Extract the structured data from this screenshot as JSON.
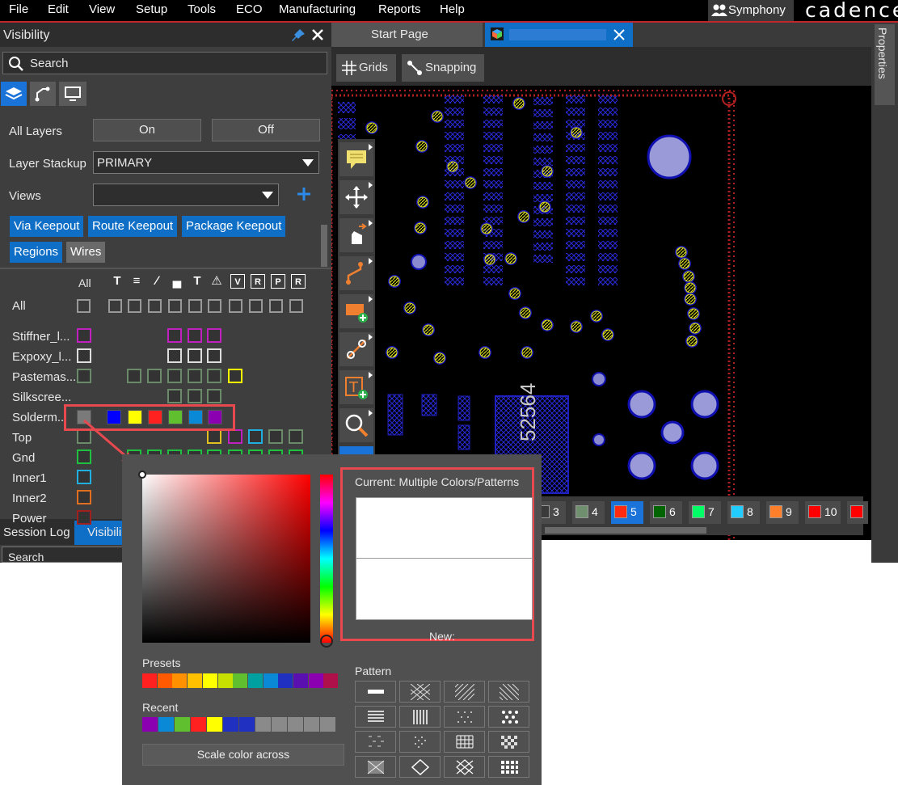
{
  "menubar": {
    "items": [
      "File",
      "Edit",
      "View",
      "Setup",
      "Tools",
      "ECO",
      "Manufacturing",
      "Reports",
      "Help"
    ],
    "symphony": "Symphony",
    "logo": "cadence"
  },
  "panel": {
    "title": "Visibility",
    "search_placeholder": "Search",
    "all_layers_label": "All Layers",
    "on_label": "On",
    "off_label": "Off",
    "layer_stackup_label": "Layer Stackup",
    "layer_stackup_value": "PRIMARY",
    "views_label": "Views",
    "chips": [
      "Via Keepout",
      "Route Keepout",
      "Package Keepout",
      "Regions"
    ],
    "wires_label": "Wires",
    "all_col_label": "All",
    "all_row_label": "All",
    "layers": [
      "Stiffner_l...",
      "Expoxy_l...",
      "Pastemas...",
      "Silkscree...",
      "Solderm...",
      "Top",
      "Gnd",
      "Inner1",
      "Inner2",
      "Power"
    ],
    "solder_colors": [
      "#7a7a7a",
      "#0000ff",
      "#ffff00",
      "#ff2020",
      "#5fbf2f",
      "#0a8ad6",
      "#8b00b0"
    ],
    "bottom_tabs": [
      "Session Log",
      "Visibili"
    ],
    "bottom_search": "Search"
  },
  "canvas": {
    "tabs": [
      "Start Page"
    ],
    "grids_label": "Grids",
    "snapping_label": "Snapping",
    "board_text": "52564",
    "layer_bar": [
      {
        "num": "3",
        "color": "#3a3a3a"
      },
      {
        "num": "4",
        "color": "#6f8f6f"
      },
      {
        "num": "5",
        "color": "#ff2a10"
      },
      {
        "num": "6",
        "color": "#006400"
      },
      {
        "num": "7",
        "color": "#00ff66"
      },
      {
        "num": "8",
        "color": "#22ccff"
      },
      {
        "num": "9",
        "color": "#ff7f2a"
      },
      {
        "num": "10",
        "color": "#ff0000"
      }
    ],
    "properties_label": "Properties"
  },
  "picker": {
    "current_label": "Current: Multiple Colors/Patterns",
    "new_label": "New:",
    "presets_label": "Presets",
    "presets": [
      "#ff2020",
      "#ff5a00",
      "#ff9000",
      "#ffc000",
      "#ffff00",
      "#c8e000",
      "#5fbf2f",
      "#00a0a0",
      "#0a8ad6",
      "#2030c0",
      "#5a10b0",
      "#8b00b0",
      "#b0104a"
    ],
    "recent_label": "Recent",
    "recent": [
      "#8b00b0",
      "#0a8ad6",
      "#5fbf2f",
      "#ff2020",
      "#ffff00",
      "#2030c0",
      "#2030c0",
      "#8a8a8a",
      "#8a8a8a",
      "#8a8a8a",
      "#8a8a8a",
      "#8a8a8a"
    ],
    "pattern_label": "Pattern",
    "scale_button": "Scale color across"
  }
}
